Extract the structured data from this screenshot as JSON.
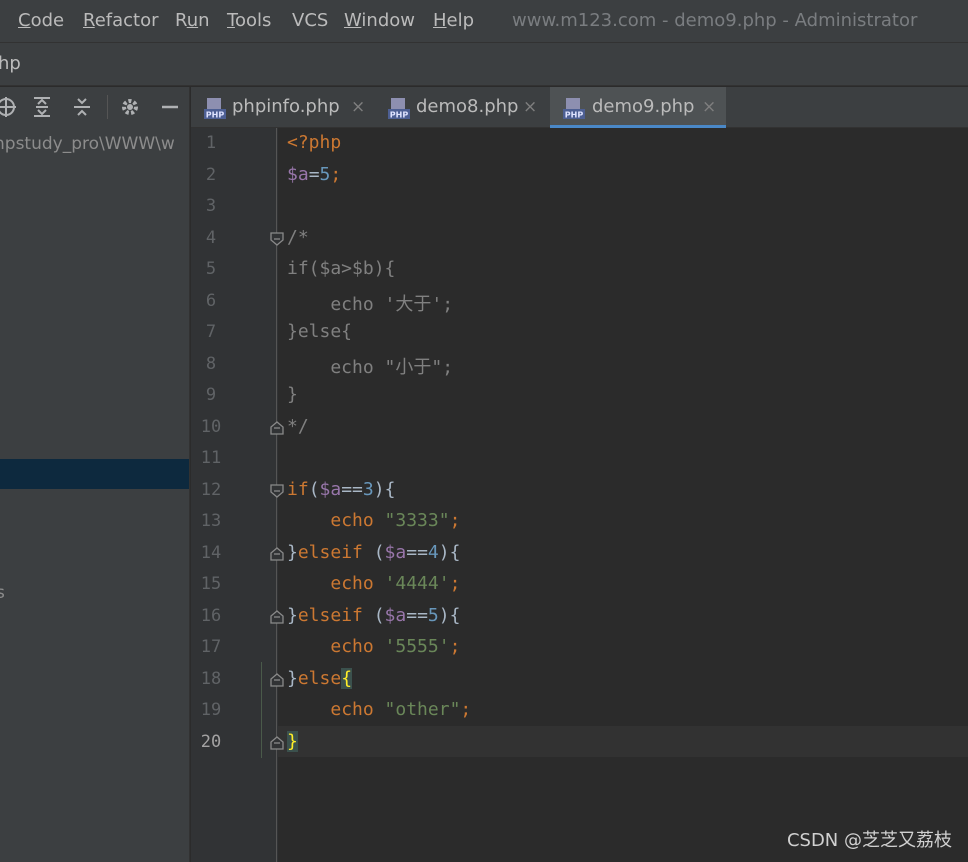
{
  "menu": {
    "items": [
      "Code",
      "Refactor",
      "Run",
      "Tools",
      "VCS",
      "Window",
      "Help"
    ],
    "mnemonics": [
      "C",
      "R",
      "u",
      "T",
      "",
      "W",
      "H"
    ],
    "window_title": "www.m123.com - demo9.php - Administrator"
  },
  "breadcrumb": {
    "text": "hp"
  },
  "project": {
    "path": "npstudy_pro\\WWW\\w",
    "fragment": "s",
    "toolbar_icons": [
      "locate-icon",
      "expand-all-icon",
      "collapse-all-icon",
      "gear-icon",
      "minimize-icon"
    ]
  },
  "tabs": [
    {
      "label": "phpinfo.php",
      "icon": "php-file-icon",
      "active": false
    },
    {
      "label": "demo8.php",
      "icon": "php-file-icon",
      "active": false
    },
    {
      "label": "demo9.php",
      "icon": "php-file-icon",
      "active": true
    }
  ],
  "tab_close_glyph": "×",
  "file_icon_text": "PHP",
  "editor": {
    "current_line": 20,
    "lines": [
      {
        "num": "1",
        "tokens": [
          [
            "k",
            "<?php"
          ]
        ]
      },
      {
        "num": "2",
        "tokens": [
          [
            "v",
            "$a"
          ],
          [
            "p",
            "="
          ],
          [
            "n",
            "5"
          ],
          [
            "k",
            ";"
          ]
        ]
      },
      {
        "num": "3",
        "tokens": []
      },
      {
        "num": "4",
        "tokens": [
          [
            "c",
            "/*"
          ]
        ],
        "fold": "open"
      },
      {
        "num": "5",
        "tokens": [
          [
            "c",
            "if($a>$b){"
          ]
        ]
      },
      {
        "num": "6",
        "tokens": [
          [
            "c",
            "    echo '大于';"
          ]
        ]
      },
      {
        "num": "7",
        "tokens": [
          [
            "c",
            "}else{"
          ]
        ]
      },
      {
        "num": "8",
        "tokens": [
          [
            "c",
            "    echo \"小于\";"
          ]
        ]
      },
      {
        "num": "9",
        "tokens": [
          [
            "c",
            "}"
          ]
        ]
      },
      {
        "num": "10",
        "tokens": [
          [
            "c",
            "*/"
          ]
        ],
        "fold": "close"
      },
      {
        "num": "11",
        "tokens": []
      },
      {
        "num": "12",
        "tokens": [
          [
            "k",
            "if"
          ],
          [
            "p",
            "("
          ],
          [
            "v",
            "$a"
          ],
          [
            "p",
            "=="
          ],
          [
            "n",
            "3"
          ],
          [
            "p",
            "){"
          ]
        ],
        "fold": "open"
      },
      {
        "num": "13",
        "tokens": [
          [
            "p",
            "    "
          ],
          [
            "k",
            "echo "
          ],
          [
            "s",
            "\"3333\""
          ],
          [
            "k",
            ";"
          ]
        ]
      },
      {
        "num": "14",
        "tokens": [
          [
            "p",
            "}"
          ],
          [
            "k",
            "elseif "
          ],
          [
            "p",
            "("
          ],
          [
            "v",
            "$a"
          ],
          [
            "p",
            "=="
          ],
          [
            "n",
            "4"
          ],
          [
            "p",
            "){"
          ]
        ],
        "fold": "close"
      },
      {
        "num": "15",
        "tokens": [
          [
            "p",
            "    "
          ],
          [
            "k",
            "echo "
          ],
          [
            "s",
            "'4444'"
          ],
          [
            "k",
            ";"
          ]
        ]
      },
      {
        "num": "16",
        "tokens": [
          [
            "p",
            "}"
          ],
          [
            "k",
            "elseif "
          ],
          [
            "p",
            "("
          ],
          [
            "v",
            "$a"
          ],
          [
            "p",
            "=="
          ],
          [
            "n",
            "5"
          ],
          [
            "p",
            "){"
          ]
        ],
        "fold": "close"
      },
      {
        "num": "17",
        "tokens": [
          [
            "p",
            "    "
          ],
          [
            "k",
            "echo "
          ],
          [
            "s",
            "'5555'"
          ],
          [
            "k",
            ";"
          ]
        ]
      },
      {
        "num": "18",
        "tokens": [
          [
            "p",
            "}"
          ],
          [
            "k",
            "else"
          ],
          [
            "hl",
            "{"
          ]
        ],
        "fold": "close"
      },
      {
        "num": "19",
        "tokens": [
          [
            "p",
            "    "
          ],
          [
            "k",
            "echo "
          ],
          [
            "s",
            "\"other\""
          ],
          [
            "k",
            ";"
          ]
        ]
      },
      {
        "num": "20",
        "tokens": [
          [
            "hl",
            "}"
          ]
        ],
        "fold": "close"
      }
    ]
  },
  "watermark": "CSDN @芝芝又荔枝",
  "colors": {
    "keyword": "#cc7832",
    "variable": "#9876aa",
    "number": "#6897bb",
    "string": "#6a8759",
    "comment": "#808080",
    "plain": "#a9b7c6",
    "tab_underline": "#4a88c7",
    "selection": "#0d293e"
  }
}
